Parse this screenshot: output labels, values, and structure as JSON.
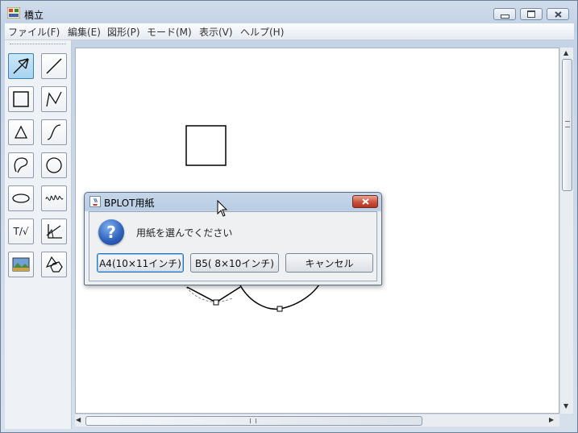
{
  "window": {
    "title": "橋立"
  },
  "menu": [
    {
      "id": "file",
      "label": "ファイル(F)"
    },
    {
      "id": "edit",
      "label": "編集(E)"
    },
    {
      "id": "shape",
      "label": "図形(P)"
    },
    {
      "id": "mode",
      "label": "モード(M)"
    },
    {
      "id": "view",
      "label": "表示(V)"
    },
    {
      "id": "help",
      "label": "ヘルプ(H)"
    }
  ],
  "tools": {
    "text_tool_label": "T/√"
  },
  "dialog": {
    "title": "BPLOT用紙",
    "message": "用紙を選んでください",
    "buttons": {
      "a4": "A4(10×11インチ)",
      "b5": "B5( 8×10インチ)",
      "cancel": "キャンセル"
    }
  },
  "colors": {
    "accent": "#3c7fb1",
    "close_button": "#c8513c",
    "question_icon": "#2b5fb9"
  }
}
